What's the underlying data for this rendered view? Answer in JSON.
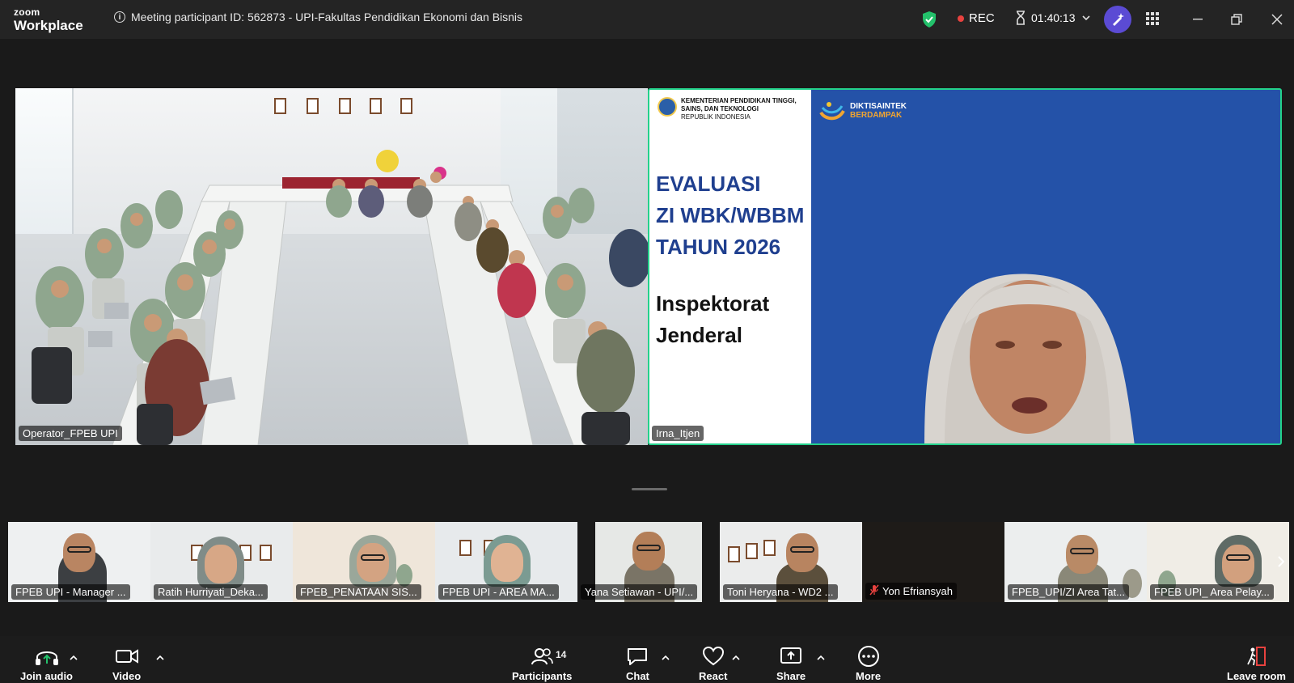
{
  "app": {
    "logo_top": "zoom",
    "logo_bottom": "Workplace"
  },
  "titlebar": {
    "meeting_info": "Meeting participant ID: 562873 - UPI-Fakultas Pendidikan Ekonomi dan Bisnis",
    "rec_label": "REC",
    "timer": "01:40:13"
  },
  "main_tiles": [
    {
      "name": "Operator_FPEB UPI"
    },
    {
      "name": "Irna_Itjen"
    }
  ],
  "slide": {
    "ministry_line1": "KEMENTERIAN PENDIDIKAN TINGGI,",
    "ministry_line2": "SAINS, DAN TEKNOLOGI",
    "ministry_line3": "REPUBLIK INDONESIA",
    "brand_line1": "DIKTISAINTEK",
    "brand_line2": "BERDAMPAK",
    "title_line1": "EVALUASI",
    "title_line2": "ZI WBK/WBBM",
    "title_line3": "TAHUN 2026",
    "subtitle_line1": "Inspektorat",
    "subtitle_line2": "Jenderal"
  },
  "gallery": [
    {
      "name": "FPEB UPI - Manager ..."
    },
    {
      "name": "Ratih Hurriyati_Deka..."
    },
    {
      "name": "FPEB_PENATAAN SIS..."
    },
    {
      "name": "FPEB UPI - AREA MA..."
    },
    {
      "name": "Yana Setiawan - UPI/..."
    },
    {
      "name": "Toni Heryana - WD2 ..."
    },
    {
      "name": "Yon Efriansyah"
    },
    {
      "name": "FPEB_UPI/ZI Area Tat..."
    },
    {
      "name": "FPEB UPI_ Area Pelay..."
    }
  ],
  "toolbar": {
    "join_audio": "Join audio",
    "video": "Video",
    "participants": "Participants",
    "participants_count": "14",
    "chat": "Chat",
    "react": "React",
    "share": "Share",
    "more": "More",
    "leave": "Leave room"
  },
  "colors": {
    "active_speaker_border": "#23d18b",
    "rec_dot": "#e8423f",
    "ai_button": "#5b4bd4",
    "slide_blue": "#2452a8"
  }
}
